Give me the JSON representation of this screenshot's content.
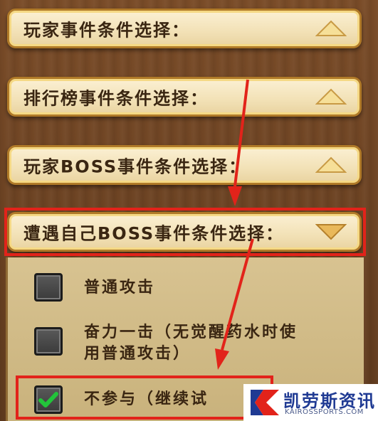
{
  "headers": [
    {
      "label": "玩家事件条件选择：",
      "state": "collapsed"
    },
    {
      "label": "排行榜事件条件选择：",
      "state": "collapsed"
    },
    {
      "label": "玩家BOSS事件条件选择：",
      "state": "collapsed"
    },
    {
      "label": "遭遇自己BOSS事件条件选择：",
      "state": "expanded"
    }
  ],
  "options": [
    {
      "label": "普通攻击",
      "checked": false
    },
    {
      "label_line1": "奋力一击（无觉醒药水时使",
      "label_line2": "用普通攻击）",
      "checked": false
    },
    {
      "label": "不参与（继续试",
      "checked": true
    }
  ],
  "watermark": {
    "name": "凯劳斯资讯",
    "url": "KAIROSSPORTS.COM"
  },
  "colors": {
    "highlight": "#e2231a",
    "arrow_fill": "#f6df98",
    "expanded_arrow_fill": "#e9b85a"
  }
}
